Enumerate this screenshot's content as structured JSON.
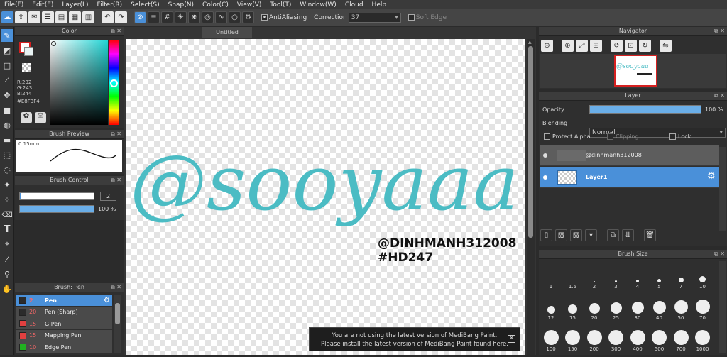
{
  "menu": [
    "File(F)",
    "Edit(E)",
    "Layer(L)",
    "Filter(R)",
    "Select(S)",
    "Snap(N)",
    "Color(C)",
    "View(V)",
    "Tool(T)",
    "Window(W)",
    "Cloud",
    "Help"
  ],
  "toolbar": {
    "antialiasing_label": "AntiAliasing",
    "correction_label": "Correction",
    "correction_value": "37",
    "soft_edge_label": "Soft Edge"
  },
  "color_panel": {
    "title": "Color",
    "r": "R:232",
    "g": "G:243",
    "b": "B:244",
    "hex_value": "#E8F3F4",
    "primary_color": "#E8F3F4",
    "accent_primary": "#d62020"
  },
  "brush_preview": {
    "title": "Brush Preview",
    "size_label": "0.15mm"
  },
  "brush_control": {
    "title": "Brush Control",
    "size_value": "2",
    "opacity_value": "100 %",
    "opacity": 1.0,
    "size_fraction": 0.02
  },
  "brush_list": {
    "title": "Brush: Pen",
    "items": [
      {
        "num": "2",
        "name": "Pen",
        "color": "#2b2b2b"
      },
      {
        "num": "20",
        "name": "Pen (Sharp)",
        "color": "#2b2b2b"
      },
      {
        "num": "15",
        "name": "G Pen",
        "color": "#e04040"
      },
      {
        "num": "15",
        "name": "Mapping Pen",
        "color": "#e04040"
      },
      {
        "num": "10",
        "name": "Edge Pen",
        "color": "#20b020"
      }
    ]
  },
  "document": {
    "tab_title": "Untitled",
    "art_text": "@sooyaaa",
    "handle_text": "@DINHMANH312008",
    "tag_text": "#HD247",
    "art_color": "#4bbcc4"
  },
  "navigator": {
    "title": "Navigator",
    "thumb_text": "@sooyaaa"
  },
  "layer_panel": {
    "title": "Layer",
    "opacity_label": "Opacity",
    "opacity_value": "100 %",
    "opacity": 1.0,
    "blending_label": "Blending",
    "blending_value": "Normal",
    "protect_alpha": "Protect Alpha",
    "clipping": "Clipping",
    "lock": "Lock",
    "layers": [
      {
        "name": "@dinhmanh312008",
        "selected": false
      },
      {
        "name": "Layer1",
        "selected": true
      }
    ]
  },
  "brush_size": {
    "title": "Brush Size",
    "sizes": [
      "1",
      "1.5",
      "2",
      "3",
      "4",
      "5",
      "7",
      "10",
      "12",
      "15",
      "20",
      "25",
      "30",
      "40",
      "50",
      "70",
      "100",
      "150",
      "200",
      "300",
      "400",
      "500",
      "700",
      "1000"
    ]
  },
  "notice": {
    "line1": "You are not using the latest version of MediBang Paint.",
    "line2": "Please install the latest version of MediBang Paint found here."
  }
}
